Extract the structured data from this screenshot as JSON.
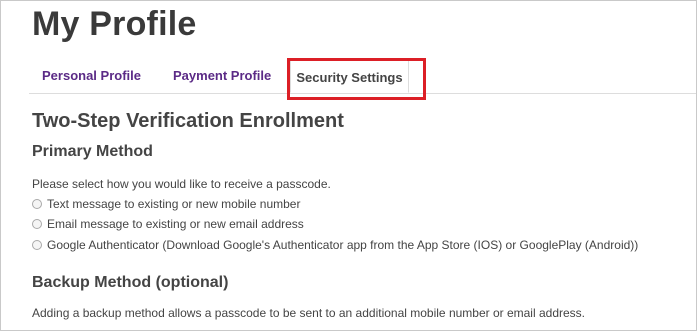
{
  "page": {
    "title": "My Profile"
  },
  "tabs": [
    {
      "label": "Personal Profile",
      "active": false
    },
    {
      "label": "Payment Profile",
      "active": false
    },
    {
      "label": "Security Settings",
      "active": true
    }
  ],
  "colors": {
    "tab_link": "#5b2a86",
    "highlight": "#dc1f26",
    "text": "#444444"
  },
  "enrollment": {
    "heading": "Two-Step Verification Enrollment",
    "primary_heading": "Primary Method",
    "prompt": "Please select how you would like to receive a passcode.",
    "options": [
      {
        "label": "Text message to existing or new mobile number",
        "selected": false
      },
      {
        "label": "Email message to existing or new email address",
        "selected": false
      },
      {
        "label": "Google Authenticator (Download Google's Authenticator app from the App Store (IOS) or GooglePlay (Android))",
        "selected": false
      }
    ],
    "backup_heading": "Backup Method (optional)",
    "backup_description": "Adding a backup method allows a passcode to be sent to an additional mobile number or email address."
  }
}
